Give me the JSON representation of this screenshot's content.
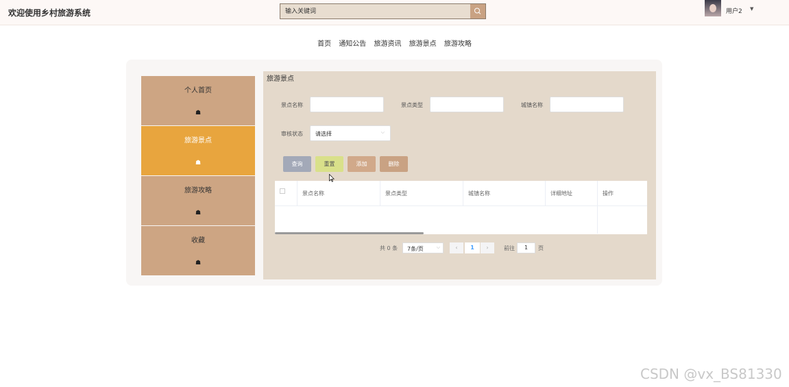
{
  "header": {
    "site_title": "欢迎使用乡村旅游系统",
    "search_placeholder": "输入关键词",
    "username": "用户2"
  },
  "nav": {
    "items": [
      "首页",
      "通知公告",
      "旅游资讯",
      "旅游景点",
      "旅游攻略"
    ]
  },
  "sidebar": {
    "items": [
      {
        "label": "个人首页",
        "icon": "home-icon",
        "active": false
      },
      {
        "label": "旅游景点",
        "icon": "home-icon",
        "active": true
      },
      {
        "label": "旅游攻略",
        "icon": "home-icon",
        "active": false
      },
      {
        "label": "收藏",
        "icon": "home-icon",
        "active": false
      }
    ]
  },
  "panel": {
    "title": "旅游景点",
    "filters": {
      "scenic_name_label": "景点名称",
      "scenic_type_label": "景点类型",
      "town_name_label": "城镇名称",
      "audit_status_label": "审核状态",
      "audit_status_value": "请选择"
    },
    "buttons": {
      "query": "查询",
      "reset": "重置",
      "add": "添加",
      "delete": "删除"
    },
    "table": {
      "columns": [
        "景点名称",
        "景点类型",
        "城镇名称",
        "详细地址",
        "操作"
      ],
      "rows": []
    },
    "pagination": {
      "total_text": "共 0 条",
      "page_size": "7条/页",
      "current_page": "1",
      "goto_label": "前往",
      "goto_value": "1",
      "page_suffix": "页"
    }
  },
  "colors": {
    "sidebar_bg": "#cda583",
    "sidebar_active": "#e8a53e",
    "panel_bg": "#e4d9cb",
    "btn_query": "#a3a9b8",
    "btn_reset": "#d9e08a",
    "btn_add": "#d1a98a",
    "btn_delete": "#c9a283"
  },
  "watermark": "CSDN @vx_BS81330"
}
